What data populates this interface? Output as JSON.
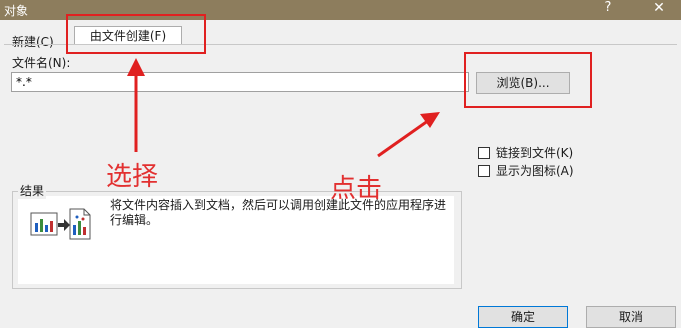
{
  "window": {
    "title": "对象",
    "help": "?",
    "close": "✕"
  },
  "tabs": [
    {
      "label": "新建(C)"
    },
    {
      "label": "由文件创建(F)"
    }
  ],
  "filename": {
    "label": "文件名(N):",
    "value": "*.*"
  },
  "browse_label": "浏览(B)...",
  "options": {
    "link_to_file": "链接到文件(K)",
    "show_as_icon": "显示为图标(A)"
  },
  "result": {
    "legend": "结果",
    "text": "将文件内容插入到文档，然后可以调用创建此文件的应用程序进行编辑。"
  },
  "buttons": {
    "ok": "确定",
    "cancel": "取消"
  },
  "annotations": {
    "select": "选择",
    "click": "点击"
  },
  "colors": {
    "highlight": "#e02020",
    "titlebar": "#8d7d5d"
  }
}
